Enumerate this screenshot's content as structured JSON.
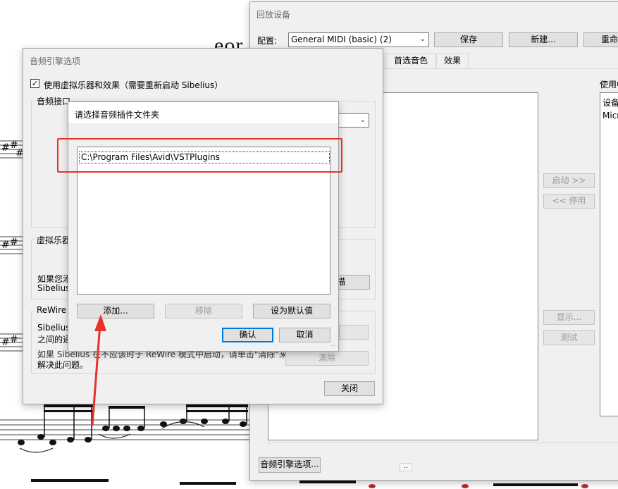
{
  "score": {
    "visible_text": "eor"
  },
  "playback_window": {
    "title": "回放设备",
    "config_label": "配置:",
    "config_value": "General MIDI (basic) (2)",
    "buttons": {
      "save": "保存",
      "new": "新建...",
      "rename": "重命"
    },
    "tabs": [
      "首选音色",
      "效果"
    ],
    "in_use_label": "使用中",
    "in_use_items": [
      "设备",
      "Micr"
    ],
    "activate_button": "启动 >>",
    "deactivate_button": "<< 停用",
    "show_button": "显示...",
    "test_button": "测试",
    "engine_options_button": "音频引擎选项...",
    "resize_grip": ".."
  },
  "engine_window": {
    "title": "音频引擎选项",
    "use_virtual_checkbox": "使用虚拟乐器和效果（需要重新启动 Sibelius）",
    "use_virtual_checked": true,
    "audio_interface_label": "音频接口",
    "virtual_instruments_label": "虚拟乐器",
    "virtual_note_line1": "如果您添",
    "virtual_note_line2": "Sibelius",
    "scan_button": "描",
    "rewire_label": "ReWire",
    "rewire_line1": "Sibelius",
    "rewire_line2": "之间的通",
    "rewire_line3": "如果 Sibelius 在不应该时于 ReWire 模式中启动，请单击\"清除\"来",
    "rewire_line4": "解决此问题。",
    "clear_button": "清除",
    "close_button": "关闭"
  },
  "folder_dialog": {
    "title": "请选择音频插件文件夹",
    "folders": [
      "C:\\Program Files\\Avid\\VSTPlugins"
    ],
    "add_button": "添加...",
    "remove_button": "移除",
    "set_default_button": "设为默认值",
    "ok_button": "确认",
    "cancel_button": "取消"
  },
  "colors": {
    "highlight": "#e8322a",
    "focus": "#0078d7"
  },
  "icons": {
    "dropdown": "chevron-down-icon",
    "check": "checkmark-icon",
    "grip": "resize-grip-icon"
  }
}
